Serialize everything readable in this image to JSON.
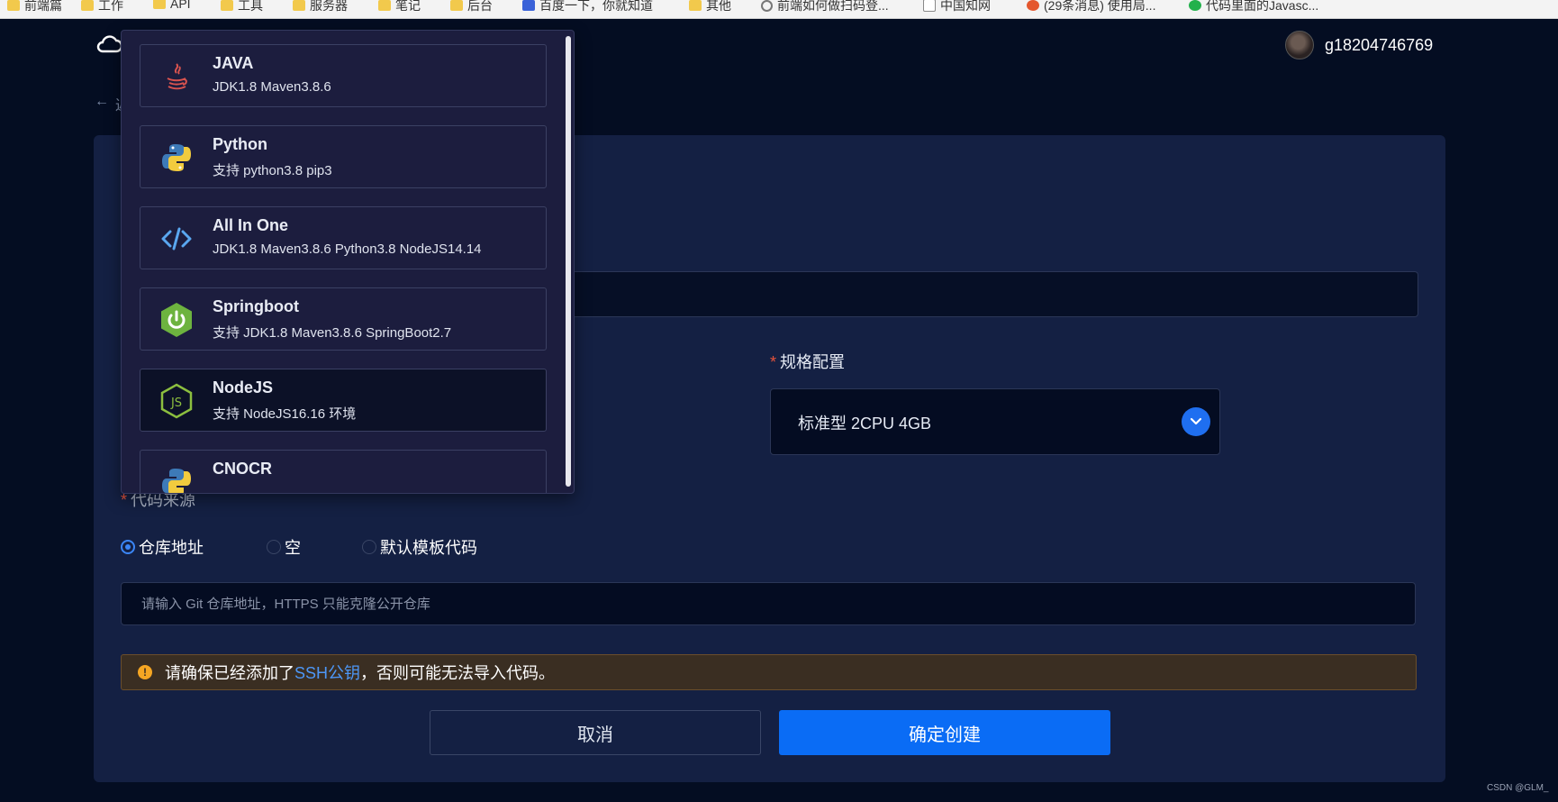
{
  "bookmarks": [
    {
      "icon": "folder",
      "label": "前端篇"
    },
    {
      "icon": "folder",
      "label": "工作"
    },
    {
      "icon": "folder",
      "label": "API"
    },
    {
      "icon": "folder",
      "label": "工具"
    },
    {
      "icon": "folder",
      "label": "服务器"
    },
    {
      "icon": "folder",
      "label": "笔记"
    },
    {
      "icon": "folder",
      "label": "后台"
    },
    {
      "icon": "baidu",
      "label": "百度一下，你就知道"
    },
    {
      "icon": "folder",
      "label": "其他"
    },
    {
      "icon": "glass",
      "label": "前端如何做扫码登..."
    },
    {
      "icon": "ext",
      "label": "中国知网"
    },
    {
      "icon": "csdn",
      "label": "(29条消息) 使用局..."
    },
    {
      "icon": "chat",
      "label": "代码里面的Javasc..."
    }
  ],
  "header": {
    "username": "g18204746769",
    "back_text": "返"
  },
  "spec": {
    "label": "规格配置",
    "required_mark": "*",
    "value": "标准型 2CPU 4GB"
  },
  "source": {
    "label": "代码来源",
    "required_mark": "*",
    "options": [
      {
        "label": "仓库地址",
        "selected": true
      },
      {
        "label": "空",
        "selected": false
      },
      {
        "label": "默认模板代码",
        "selected": false
      }
    ],
    "git_placeholder": "请输入 Git 仓库地址，HTTPS 只能克隆公开仓库"
  },
  "notice": {
    "prefix": "请确保已经添加了 ",
    "link": "SSH公钥",
    "suffix": "，否则可能无法导入代码。",
    "accent": "#f5a623"
  },
  "buttons": {
    "cancel": "取消",
    "confirm": "确定创建"
  },
  "dropdown": {
    "options": [
      {
        "name": "JAVA",
        "desc": "JDK1.8 Maven3.8.6",
        "icon": "java-icon"
      },
      {
        "name": "Python",
        "desc": "支持 python3.8 pip3",
        "icon": "python-icon"
      },
      {
        "name": "All In One",
        "desc": "JDK1.8 Maven3.8.6 Python3.8 NodeJS14.14",
        "icon": "code-icon"
      },
      {
        "name": "Springboot",
        "desc": "支持 JDK1.8 Maven3.8.6 SpringBoot2.7",
        "icon": "springboot-icon"
      },
      {
        "name": "NodeJS",
        "desc": "支持 NodeJS16.16 环境",
        "icon": "nodejs-icon"
      },
      {
        "name": "CNOCR",
        "desc": "",
        "icon": "python-icon"
      }
    ]
  },
  "watermark": "CSDN @GLM_"
}
